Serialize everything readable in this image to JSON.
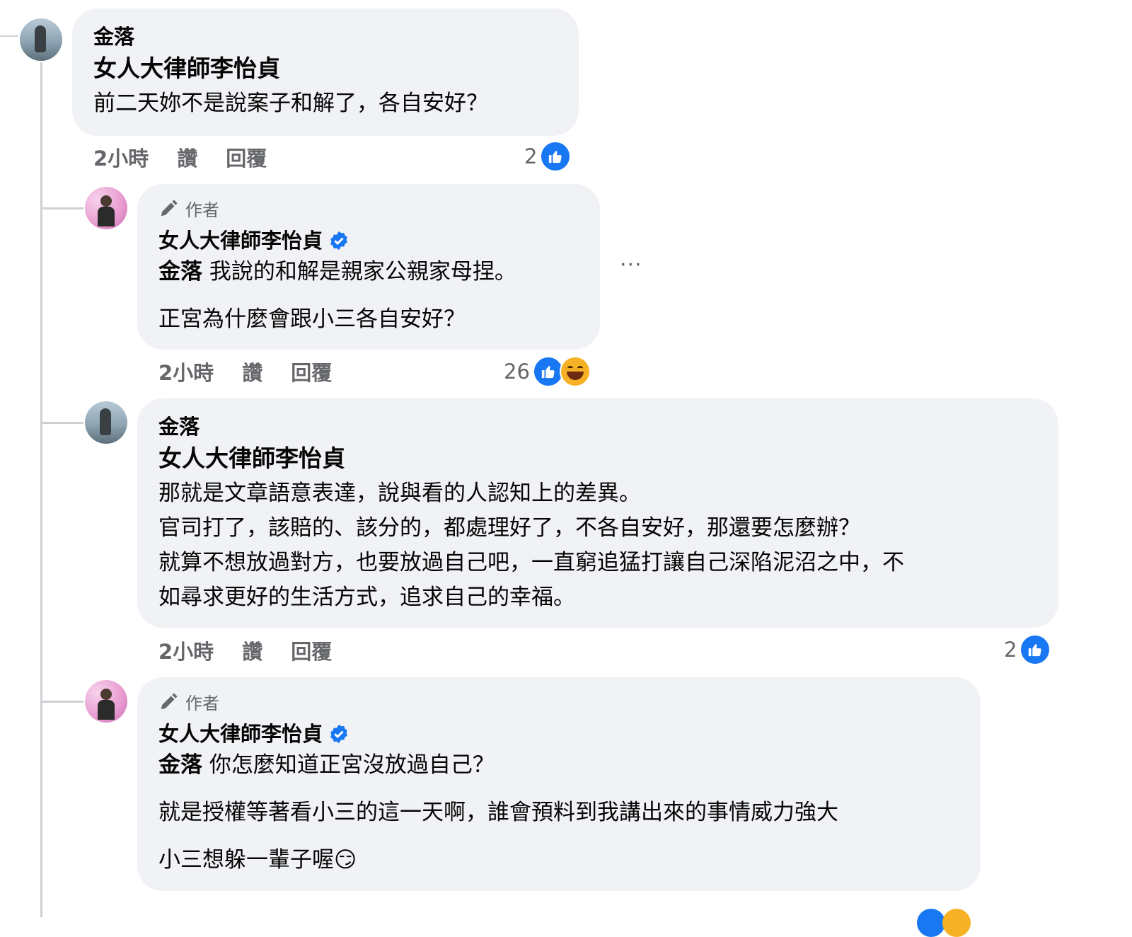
{
  "comments": [
    {
      "author": "金落",
      "mention": "女人大律師李怡貞",
      "lines": [
        "前二天妳不是說案子和解了，各自安好？"
      ],
      "time": "2小時",
      "like_action": "讚",
      "reply_action": "回覆",
      "reaction_count": "2"
    },
    {
      "author_badge": "作者",
      "author": "女人大律師李怡貞",
      "mention": "金落",
      "lines": [
        "我說的和解是親家公親家母捏。",
        "正宮為什麼會跟小三各自安好？"
      ],
      "time": "2小時",
      "like_action": "讚",
      "reply_action": "回覆",
      "reaction_count": "26",
      "more": "···"
    },
    {
      "author": "金落",
      "mention": "女人大律師李怡貞",
      "lines": [
        "那就是文章語意表達，說與看的人認知上的差異。",
        "官司打了，該賠的、該分的，都處理好了，不各自安好，那還要怎麼辦？",
        "就算不想放過對方，也要放過自己吧，一直窮追猛打讓自己深陷泥沼之中，不",
        "如尋求更好的生活方式，追求自己的幸福。"
      ],
      "time": "2小時",
      "like_action": "讚",
      "reply_action": "回覆",
      "reaction_count": "2"
    },
    {
      "author_badge": "作者",
      "author": "女人大律師李怡貞",
      "mention": "金落",
      "lines": [
        "你怎麼知道正宮沒放過自己？",
        "就是授權等著看小三的這一天啊，誰會預料到我講出來的事情威力強大",
        "小三想躲一輩子喔😏"
      ]
    }
  ],
  "colors": {
    "bubble": "#f0f2f5",
    "secondary_text": "#65676b",
    "like_blue": "#1877f2",
    "verified_blue": "#1877f2",
    "thread_line": "#ced0d4"
  }
}
